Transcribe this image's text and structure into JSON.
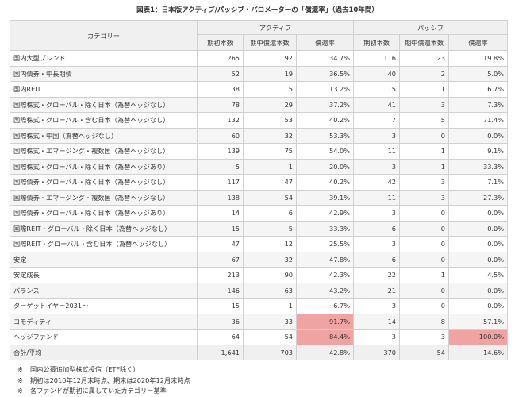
{
  "title": "図表1：日本版アクティブ/パッシブ・バロメーターの「償還率」（過去10年間）",
  "headers": {
    "category": "カテゴリー",
    "active": "アクティブ",
    "passive": "パッシブ",
    "initial": "期初本数",
    "redeemed": "期中償還本数",
    "rate": "償還率"
  },
  "rows": [
    {
      "label": "国内大型ブレンド",
      "a_init": "265",
      "a_red": "92",
      "a_rate": "34.7%",
      "p_init": "116",
      "p_red": "23",
      "p_rate": "19.8%"
    },
    {
      "label": "国内債券・中長期債",
      "a_init": "52",
      "a_red": "19",
      "a_rate": "36.5%",
      "p_init": "40",
      "p_red": "2",
      "p_rate": "5.0%"
    },
    {
      "label": "国内REIT",
      "a_init": "38",
      "a_red": "5",
      "a_rate": "13.2%",
      "p_init": "15",
      "p_red": "1",
      "p_rate": "6.7%"
    },
    {
      "label": "国際株式・グローバル・除く日本（為替ヘッジなし）",
      "a_init": "78",
      "a_red": "29",
      "a_rate": "37.2%",
      "p_init": "41",
      "p_red": "3",
      "p_rate": "7.3%"
    },
    {
      "label": "国際株式・グローバル・含む日本（為替ヘッジなし）",
      "a_init": "132",
      "a_red": "53",
      "a_rate": "40.2%",
      "p_init": "7",
      "p_red": "5",
      "p_rate": "71.4%"
    },
    {
      "label": "国際株式・中国（為替ヘッジなし）",
      "a_init": "60",
      "a_red": "32",
      "a_rate": "53.3%",
      "p_init": "3",
      "p_red": "0",
      "p_rate": "0.0%"
    },
    {
      "label": "国際株式・エマージング・複数国（為替ヘッジなし）",
      "a_init": "139",
      "a_red": "75",
      "a_rate": "54.0%",
      "p_init": "11",
      "p_red": "1",
      "p_rate": "9.1%"
    },
    {
      "label": "国際株式・グローバル・除く日本（為替ヘッジあり）",
      "a_init": "5",
      "a_red": "1",
      "a_rate": "20.0%",
      "p_init": "3",
      "p_red": "1",
      "p_rate": "33.3%"
    },
    {
      "label": "国際債券・グローバル・除く日本（為替ヘッジなし）",
      "a_init": "117",
      "a_red": "47",
      "a_rate": "40.2%",
      "p_init": "42",
      "p_red": "3",
      "p_rate": "7.1%"
    },
    {
      "label": "国際債券・エマージング・複数国（為替ヘッジなし）",
      "a_init": "138",
      "a_red": "54",
      "a_rate": "39.1%",
      "p_init": "11",
      "p_red": "3",
      "p_rate": "27.3%"
    },
    {
      "label": "国際債券・グローバル・除く日本（為替ヘッジあり）",
      "a_init": "14",
      "a_red": "6",
      "a_rate": "42.9%",
      "p_init": "3",
      "p_red": "0",
      "p_rate": "0.0%"
    },
    {
      "label": "国際REIT・グローバル・除く日本（為替ヘッジなし）",
      "a_init": "15",
      "a_red": "5",
      "a_rate": "33.3%",
      "p_init": "6",
      "p_red": "0",
      "p_rate": "0.0%"
    },
    {
      "label": "国際REIT・グローバル・含む日本（為替ヘッジなし）",
      "a_init": "47",
      "a_red": "12",
      "a_rate": "25.5%",
      "p_init": "3",
      "p_red": "0",
      "p_rate": "0.0%"
    },
    {
      "label": "安定",
      "a_init": "67",
      "a_red": "32",
      "a_rate": "47.8%",
      "p_init": "6",
      "p_red": "0",
      "p_rate": "0.0%"
    },
    {
      "label": "安定成長",
      "a_init": "213",
      "a_red": "90",
      "a_rate": "42.3%",
      "p_init": "22",
      "p_red": "1",
      "p_rate": "4.5%"
    },
    {
      "label": "バランス",
      "a_init": "146",
      "a_red": "63",
      "a_rate": "43.2%",
      "p_init": "21",
      "p_red": "0",
      "p_rate": "0.0%"
    },
    {
      "label": "ターゲットイヤー2031～",
      "a_init": "15",
      "a_red": "1",
      "a_rate": "6.7%",
      "p_init": "3",
      "p_red": "0",
      "p_rate": "0.0%"
    },
    {
      "label": "コモディティ",
      "a_init": "36",
      "a_red": "33",
      "a_rate": "91.7%",
      "p_init": "14",
      "p_red": "8",
      "p_rate": "57.1%"
    },
    {
      "label": "ヘッジファンド",
      "a_init": "64",
      "a_red": "54",
      "a_rate": "84.4%",
      "p_init": "3",
      "p_red": "3",
      "p_rate": "100.0%"
    }
  ],
  "total": {
    "label": "合計/平均",
    "a_init": "1,641",
    "a_red": "703",
    "a_rate": "42.8%",
    "p_init": "370",
    "p_red": "54",
    "p_rate": "14.6%"
  },
  "highlight_color": "#f0a3a3",
  "notes": {
    "mark": "※",
    "n1": "国内公募追加型株式投信（ETF除く）",
    "n2": "期初は2010年12月末時点、期末は2020年12月末時点",
    "n3": "各ファンドが期初に属していたカテゴリー基準"
  }
}
